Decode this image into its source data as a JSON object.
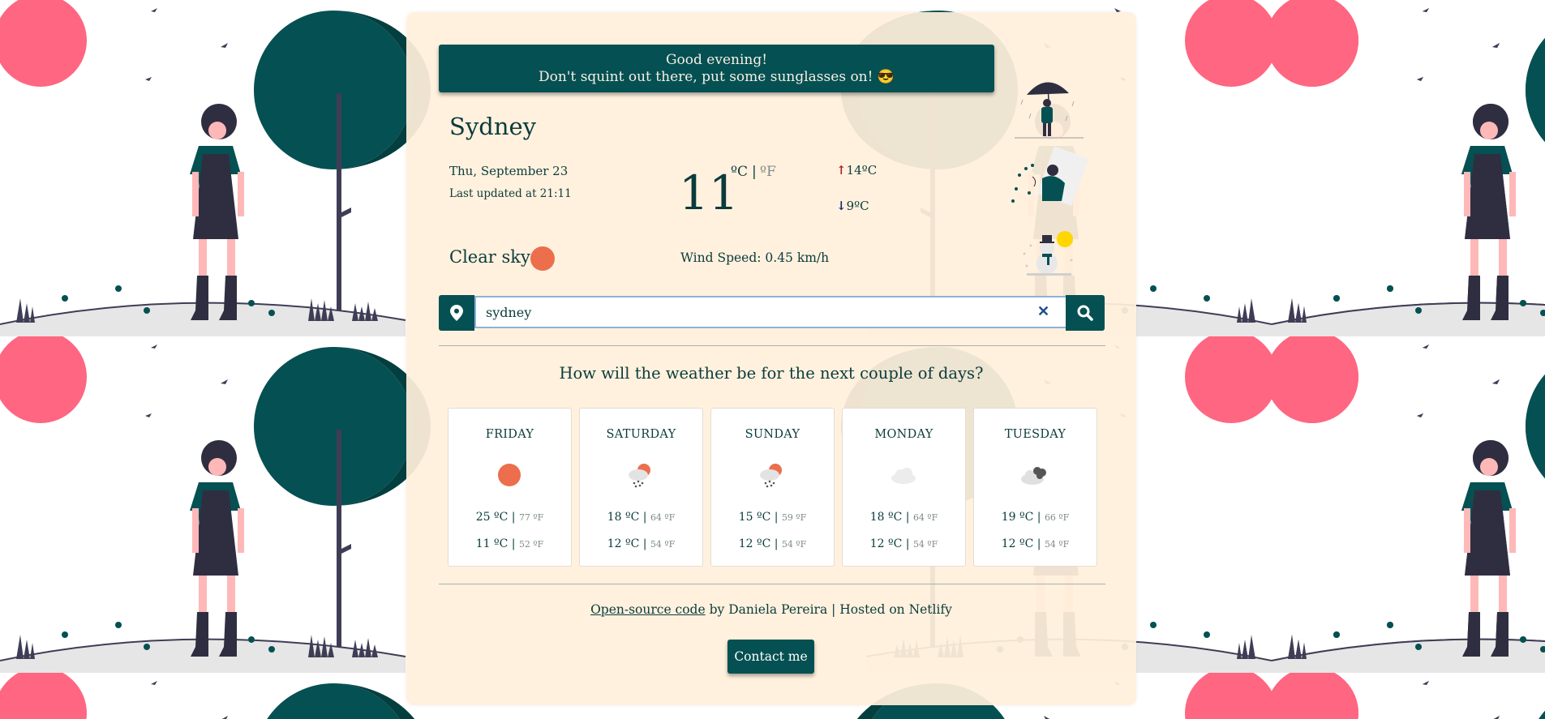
{
  "banner": {
    "line1": "Good evening!",
    "line2": "Don't squint out there, put some sunglasses on! 😎"
  },
  "current": {
    "city": "Sydney",
    "date": "Thu, September 23",
    "updated_prefix": "Last updated at ",
    "updated_time": "21:11",
    "condition": "Clear sky",
    "temperature": "11",
    "unit_c": "ºC",
    "unit_separator": "|",
    "unit_f": "ºF",
    "high_arrow": "↑",
    "high": "14ºC",
    "low_arrow": "↓",
    "low": "9ºC",
    "wind": "Wind Speed: 0.45 km/h"
  },
  "search": {
    "value": "sydney",
    "clear_label": "✕"
  },
  "forecast": {
    "title": "How will the weather be for the next couple of days?",
    "days": [
      {
        "name": "FRIDAY",
        "icon": "sun-icon",
        "max_c": "25 ºC",
        "max_f": "77 ºF",
        "min_c": "11 ºC",
        "min_f": "52 ºF"
      },
      {
        "name": "SATURDAY",
        "icon": "rain-sun-icon",
        "max_c": "18 ºC",
        "max_f": "64 ºF",
        "min_c": "12 ºC",
        "min_f": "54 ºF"
      },
      {
        "name": "SUNDAY",
        "icon": "rain-sun-icon",
        "max_c": "15 ºC",
        "max_f": "59 ºF",
        "min_c": "12 ºC",
        "min_f": "54 ºF"
      },
      {
        "name": "MONDAY",
        "icon": "cloud-icon",
        "max_c": "18 ºC",
        "max_f": "64 ºF",
        "min_c": "12 ºC",
        "min_f": "54 ºF"
      },
      {
        "name": "TUESDAY",
        "icon": "dark-clouds-icon",
        "max_c": "19 ºC",
        "max_f": "66 ºF",
        "min_c": "12 ºC",
        "min_f": "54 ºF"
      }
    ]
  },
  "footer": {
    "link": "Open-source code",
    "text": " by Daniela Pereira | Hosted on Netlify",
    "contact": "Contact me"
  },
  "colors": {
    "primary": "#055052",
    "card": "#fff0db",
    "pink": "#ff6681",
    "sun": "#ec6e4c"
  }
}
